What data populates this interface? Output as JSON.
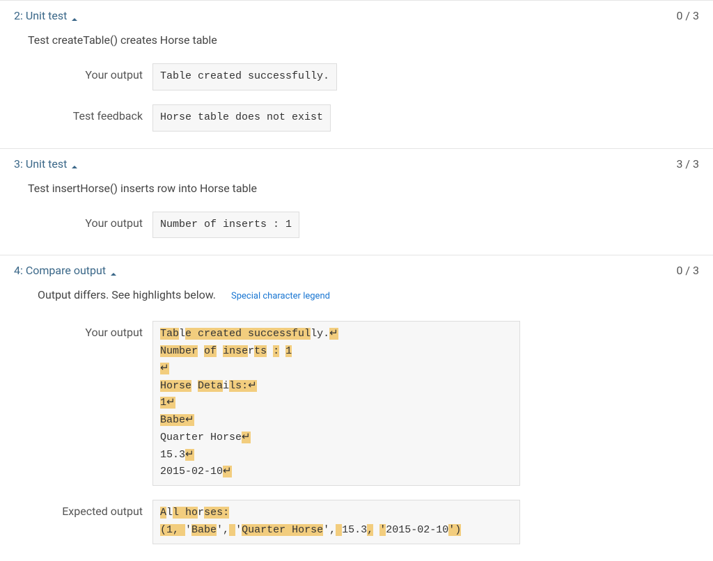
{
  "tests": [
    {
      "number": "2",
      "label": "Unit test",
      "score": "0 / 3",
      "description": "Test createTable() creates Horse table",
      "rows": [
        {
          "label": "Your output",
          "content": "Table created successfully."
        },
        {
          "label": "Test feedback",
          "content": "Horse table does not exist"
        }
      ]
    },
    {
      "number": "3",
      "label": "Unit test",
      "score": "3 / 3",
      "description": "Test insertHorse() inserts row into Horse table",
      "rows": [
        {
          "label": "Your output",
          "content": "Number of inserts : 1"
        }
      ]
    },
    {
      "number": "4",
      "label": "Compare output",
      "score": "0 / 3",
      "differs_text": "Output differs. See highlights below.",
      "legend_text": "Special character legend",
      "your_output_label": "Your output",
      "expected_output_label": "Expected output"
    }
  ],
  "compare_your_output": {
    "line1_p1": "Tab",
    "line1_p2": "l",
    "line1_p3": "e created successful",
    "line1_p4": "ly.",
    "line2_p1": "Number",
    "line2_p2": " ",
    "line2_p3": "of",
    "line2_p4": " ",
    "line2_p5": "inse",
    "line2_p6": "r",
    "line2_p7": "ts",
    "line2_p8": " ",
    "line2_p9": ":",
    "line2_p10": " ",
    "line2_p11": "1",
    "line4_p1": "Horse",
    "line4_p2": " ",
    "line4_p3": "Deta",
    "line4_p4": "i",
    "line4_p5": "ls:",
    "line5_p1": "1",
    "line6_p1": "Babe",
    "line7_p1": "Quarter Horse",
    "line8_p1": "15.3",
    "line9_p1": "2015-02-10"
  },
  "compare_expected_output": {
    "line1_p1": "A",
    "line1_p2": "l",
    "line1_p3": "l ho",
    "line1_p4": "r",
    "line1_p5": "ses:",
    "line2_p1": "(1, ",
    "line2_p2": "'",
    "line2_p3": "Babe",
    "line2_p4": "',",
    "line2_p5": " ",
    "line2_p6": "'",
    "line2_p7": "Quarter Horse",
    "line2_p8": "',",
    "line2_p9": " ",
    "line2_p10": "15.3",
    "line2_p11": ",",
    "line2_p12": " ",
    "line2_p13": "'",
    "line2_p14": "2015-02-10",
    "line2_p15": "')"
  }
}
